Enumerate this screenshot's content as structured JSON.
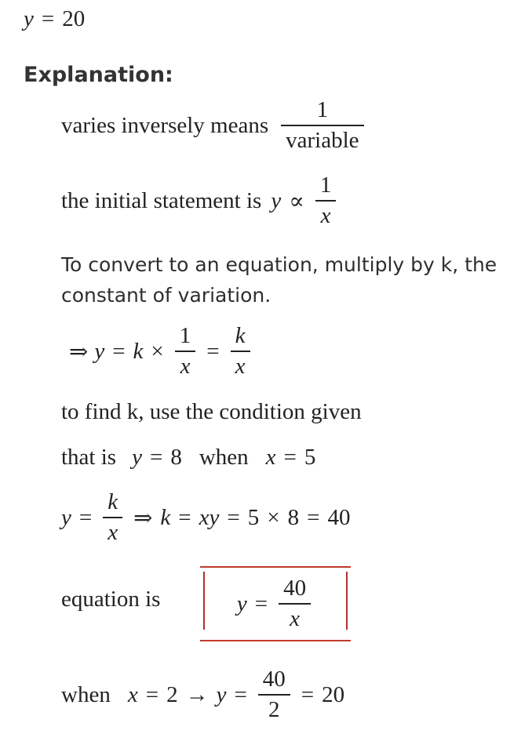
{
  "answer": {
    "lhs": "y",
    "eq": "=",
    "rhs": "20"
  },
  "heading": "Explanation:",
  "colors": {
    "text": "#222222",
    "box_border": "#c0392b"
  },
  "lines": {
    "l1": {
      "text": "varies inversely means",
      "num": "1",
      "den": "variable"
    },
    "l2": {
      "text": "the initial statement is",
      "lhs": "y",
      "op": "∝",
      "num": "1",
      "den": "x"
    },
    "l3": {
      "text_line1": "To convert to an equation, multiply by k, the",
      "text_line2": "constant of variation."
    },
    "l4": {
      "arrow": "⇒",
      "y": "y",
      "eq1": "=",
      "k": "k",
      "times": "×",
      "num1": "1",
      "den1": "x",
      "eq2": "=",
      "num2": "k",
      "den2": "x"
    },
    "l5": {
      "text": "to find k, use the condition given"
    },
    "l6": {
      "text1": "that is",
      "y": "y",
      "eq1": "=",
      "yval": "8",
      "text2": "when",
      "x": "x",
      "eq2": "=",
      "xval": "5"
    },
    "l7": {
      "y": "y",
      "eq1": "=",
      "num": "k",
      "den": "x",
      "arrow": "⇒",
      "k": "k",
      "eq2": "=",
      "xy": "xy",
      "eq3": "=",
      "a": "5",
      "times": "×",
      "b": "8",
      "eq4": "=",
      "result": "40"
    },
    "l8": {
      "text": "equation is",
      "y": "y",
      "eq": "=",
      "num": "40",
      "den": "x"
    },
    "l9": {
      "text": "when",
      "x": "x",
      "eq1": "=",
      "xval": "2",
      "arrow": "→",
      "y": "y",
      "eq2": "=",
      "num": "40",
      "den": "2",
      "eq3": "=",
      "result": "20"
    }
  }
}
